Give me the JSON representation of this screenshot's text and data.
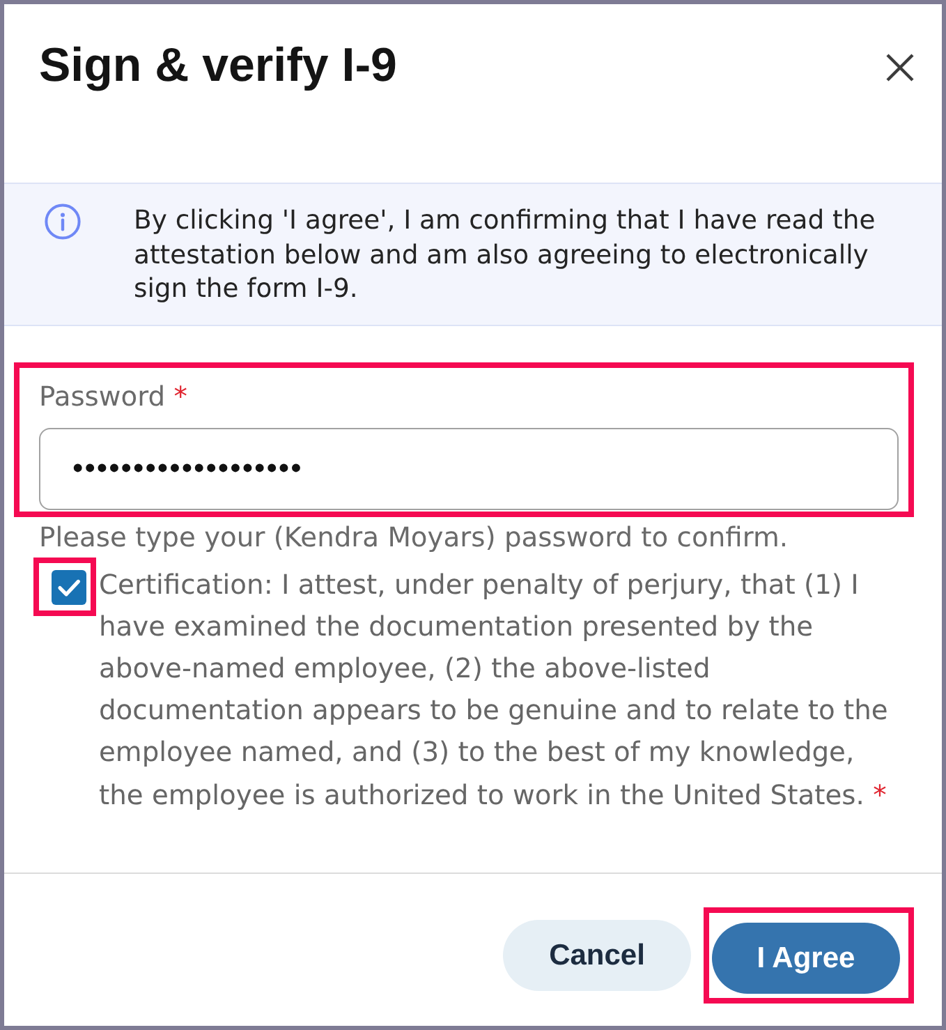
{
  "dialog": {
    "title": "Sign & verify I-9"
  },
  "notice": {
    "text": "By clicking 'I agree', I am confirming that I have read the attestation below and am also agreeing to electronically sign the form I-9."
  },
  "password": {
    "label": "Password",
    "required_mark": "*",
    "value": "•••••••••••••••••••",
    "highlighted": true
  },
  "hint": "Please type your (Kendra Moyars) password to confirm.",
  "certification": {
    "checked": true,
    "highlighted": true,
    "text": "Certification: I attest, under penalty of perjury, that (1) I have examined the documentation presented by the above-named employee, (2) the above-listed documentation appears to be genuine and to relate to the employee named, and (3) to the best of my knowledge, the employee is authorized to work in the United States.",
    "required_mark": "*"
  },
  "buttons": [
    {
      "label": "Cancel",
      "kind": "cancel",
      "highlighted": false
    },
    {
      "label": "I Agree",
      "kind": "confirm",
      "highlighted": true
    }
  ]
}
